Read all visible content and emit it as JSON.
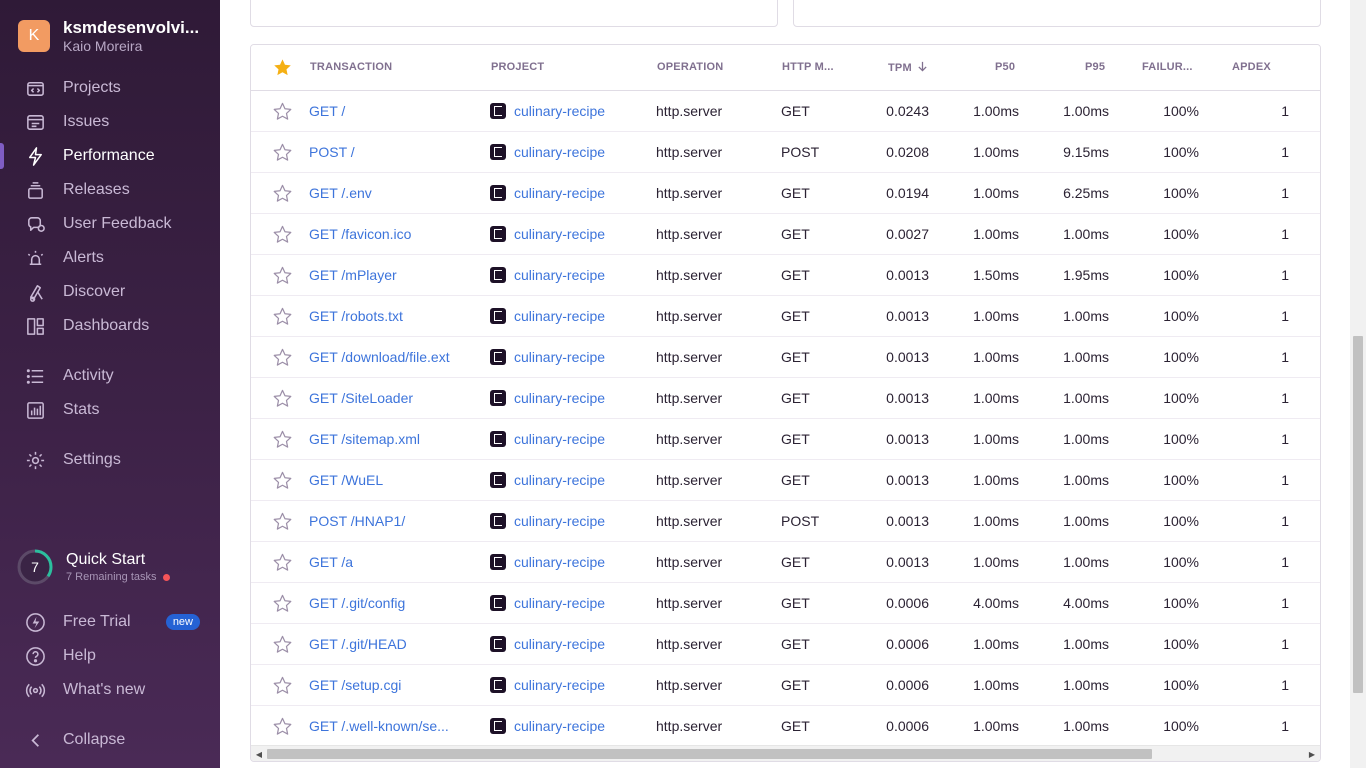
{
  "org": {
    "initial": "K",
    "name": "ksmdesenvolvi...",
    "user": "Kaio Moreira"
  },
  "nav": [
    {
      "label": "Projects",
      "icon": "projects-icon",
      "name": "nav-projects"
    },
    {
      "label": "Issues",
      "icon": "issues-icon",
      "name": "nav-issues"
    },
    {
      "label": "Performance",
      "icon": "performance-icon",
      "name": "nav-performance",
      "active": true
    },
    {
      "label": "Releases",
      "icon": "releases-icon",
      "name": "nav-releases"
    },
    {
      "label": "User Feedback",
      "icon": "user-feedback-icon",
      "name": "nav-user-feedback"
    },
    {
      "label": "Alerts",
      "icon": "alerts-icon",
      "name": "nav-alerts"
    },
    {
      "label": "Discover",
      "icon": "discover-icon",
      "name": "nav-discover"
    },
    {
      "label": "Dashboards",
      "icon": "dashboards-icon",
      "name": "nav-dashboards"
    },
    {
      "label": "Activity",
      "icon": "activity-icon",
      "name": "nav-activity"
    },
    {
      "label": "Stats",
      "icon": "stats-icon",
      "name": "nav-stats"
    },
    {
      "label": "Settings",
      "icon": "settings-icon",
      "name": "nav-settings"
    }
  ],
  "quick_start": {
    "count": "7",
    "title": "Quick Start",
    "subtitle": "7 Remaining tasks"
  },
  "bottom_nav": {
    "free_trial": "Free Trial",
    "new_badge": "new",
    "help": "Help",
    "whats_new": "What's new",
    "collapse": "Collapse"
  },
  "table": {
    "headers": {
      "transaction": "TRANSACTION",
      "project": "PROJECT",
      "operation": "OPERATION",
      "http_method": "HTTP M...",
      "tpm": "TPM",
      "p50": "P50",
      "p95": "P95",
      "failure": "FAILUR...",
      "apdex": "APDEX"
    },
    "sort_column": "tpm",
    "sort_direction": "descending",
    "rows": [
      {
        "transaction": "GET /",
        "project": "culinary-recipe",
        "operation": "http.server",
        "method": "GET",
        "tpm": "0.0243",
        "p50": "1.00ms",
        "p95": "1.00ms",
        "failure": "100%",
        "apdex": "1"
      },
      {
        "transaction": "POST /",
        "project": "culinary-recipe",
        "operation": "http.server",
        "method": "POST",
        "tpm": "0.0208",
        "p50": "1.00ms",
        "p95": "9.15ms",
        "failure": "100%",
        "apdex": "1"
      },
      {
        "transaction": "GET /.env",
        "project": "culinary-recipe",
        "operation": "http.server",
        "method": "GET",
        "tpm": "0.0194",
        "p50": "1.00ms",
        "p95": "6.25ms",
        "failure": "100%",
        "apdex": "1"
      },
      {
        "transaction": "GET /favicon.ico",
        "project": "culinary-recipe",
        "operation": "http.server",
        "method": "GET",
        "tpm": "0.0027",
        "p50": "1.00ms",
        "p95": "1.00ms",
        "failure": "100%",
        "apdex": "1"
      },
      {
        "transaction": "GET /mPlayer",
        "project": "culinary-recipe",
        "operation": "http.server",
        "method": "GET",
        "tpm": "0.0013",
        "p50": "1.50ms",
        "p95": "1.95ms",
        "failure": "100%",
        "apdex": "1"
      },
      {
        "transaction": "GET /robots.txt",
        "project": "culinary-recipe",
        "operation": "http.server",
        "method": "GET",
        "tpm": "0.0013",
        "p50": "1.00ms",
        "p95": "1.00ms",
        "failure": "100%",
        "apdex": "1"
      },
      {
        "transaction": "GET /download/file.ext",
        "project": "culinary-recipe",
        "operation": "http.server",
        "method": "GET",
        "tpm": "0.0013",
        "p50": "1.00ms",
        "p95": "1.00ms",
        "failure": "100%",
        "apdex": "1"
      },
      {
        "transaction": "GET /SiteLoader",
        "project": "culinary-recipe",
        "operation": "http.server",
        "method": "GET",
        "tpm": "0.0013",
        "p50": "1.00ms",
        "p95": "1.00ms",
        "failure": "100%",
        "apdex": "1"
      },
      {
        "transaction": "GET /sitemap.xml",
        "project": "culinary-recipe",
        "operation": "http.server",
        "method": "GET",
        "tpm": "0.0013",
        "p50": "1.00ms",
        "p95": "1.00ms",
        "failure": "100%",
        "apdex": "1"
      },
      {
        "transaction": "GET /WuEL",
        "project": "culinary-recipe",
        "operation": "http.server",
        "method": "GET",
        "tpm": "0.0013",
        "p50": "1.00ms",
        "p95": "1.00ms",
        "failure": "100%",
        "apdex": "1"
      },
      {
        "transaction": "POST /HNAP1/",
        "project": "culinary-recipe",
        "operation": "http.server",
        "method": "POST",
        "tpm": "0.0013",
        "p50": "1.00ms",
        "p95": "1.00ms",
        "failure": "100%",
        "apdex": "1"
      },
      {
        "transaction": "GET /a",
        "project": "culinary-recipe",
        "operation": "http.server",
        "method": "GET",
        "tpm": "0.0013",
        "p50": "1.00ms",
        "p95": "1.00ms",
        "failure": "100%",
        "apdex": "1"
      },
      {
        "transaction": "GET /.git/config",
        "project": "culinary-recipe",
        "operation": "http.server",
        "method": "GET",
        "tpm": "0.0006",
        "p50": "4.00ms",
        "p95": "4.00ms",
        "failure": "100%",
        "apdex": "1"
      },
      {
        "transaction": "GET /.git/HEAD",
        "project": "culinary-recipe",
        "operation": "http.server",
        "method": "GET",
        "tpm": "0.0006",
        "p50": "1.00ms",
        "p95": "1.00ms",
        "failure": "100%",
        "apdex": "1"
      },
      {
        "transaction": "GET /setup.cgi",
        "project": "culinary-recipe",
        "operation": "http.server",
        "method": "GET",
        "tpm": "0.0006",
        "p50": "1.00ms",
        "p95": "1.00ms",
        "failure": "100%",
        "apdex": "1"
      },
      {
        "transaction": "GET /.well-known/se...",
        "project": "culinary-recipe",
        "operation": "http.server",
        "method": "GET",
        "tpm": "0.0006",
        "p50": "1.00ms",
        "p95": "1.00ms",
        "failure": "100%",
        "apdex": "1"
      }
    ]
  },
  "colors": {
    "sidebar_top": "#2f1a37",
    "sidebar_bottom": "#4a2a56",
    "accent": "#7f5dc3",
    "link": "#3d74db",
    "star_active": "#f5b014",
    "org_avatar": "#f29b62",
    "alert_dot": "#f55459",
    "new_badge": "#2562d4"
  }
}
